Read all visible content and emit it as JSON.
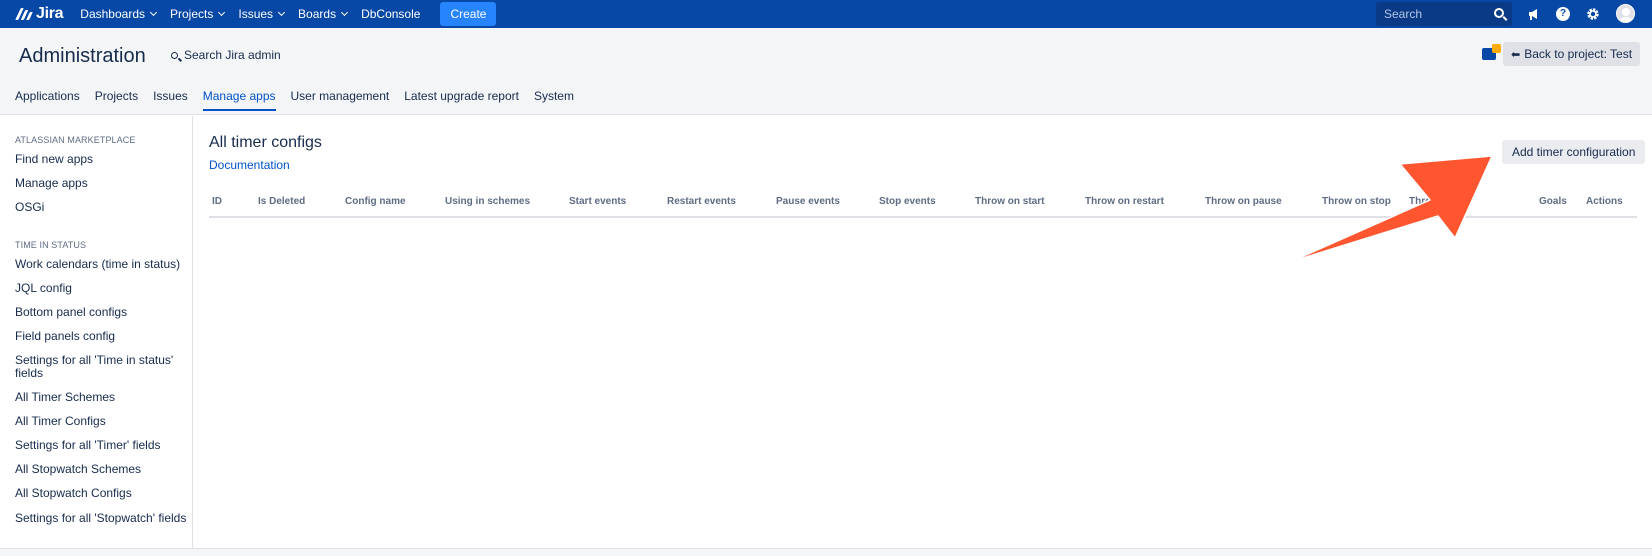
{
  "topbar": {
    "logo_text": "Jira",
    "nav": [
      {
        "label": "Dashboards",
        "dropdown": true
      },
      {
        "label": "Projects",
        "dropdown": true
      },
      {
        "label": "Issues",
        "dropdown": true
      },
      {
        "label": "Boards",
        "dropdown": true
      },
      {
        "label": "DbConsole",
        "dropdown": false
      }
    ],
    "create_label": "Create",
    "search_placeholder": "Search",
    "help_glyph": "?",
    "icons": [
      "megaphone-icon",
      "help-icon",
      "gear-icon",
      "avatar"
    ],
    "bg_color": "#0747a6"
  },
  "admin": {
    "title": "Administration",
    "search_label": "Search Jira admin",
    "back_label": "Back to project: Test",
    "tabs": [
      {
        "label": "Applications",
        "active": false
      },
      {
        "label": "Projects",
        "active": false
      },
      {
        "label": "Issues",
        "active": false
      },
      {
        "label": "Manage apps",
        "active": true
      },
      {
        "label": "User management",
        "active": false
      },
      {
        "label": "Latest upgrade report",
        "active": false
      },
      {
        "label": "System",
        "active": false
      }
    ]
  },
  "sidebar": {
    "sections": [
      {
        "heading": "ATLASSIAN MARKETPLACE",
        "items": [
          "Find new apps",
          "Manage apps",
          "OSGi"
        ]
      },
      {
        "heading": "TIME IN STATUS",
        "items": [
          "Work calendars (time in status)",
          "JQL config",
          "Bottom panel configs",
          "Field panels config",
          "Settings for all 'Time in status' fields",
          "All Timer Schemes",
          "All Timer Configs",
          "Settings for all 'Timer' fields",
          "All Stopwatch Schemes",
          "All Stopwatch Configs",
          "Settings for all 'Stopwatch' fields"
        ]
      }
    ]
  },
  "main": {
    "title": "All timer configs",
    "doc_link": "Documentation",
    "add_button": "Add timer configuration",
    "columns": [
      "ID",
      "Is Deleted",
      "Config name",
      "Using in schemes",
      "Start events",
      "Restart events",
      "Pause events",
      "Stop events",
      "Throw on start",
      "Throw on restart",
      "Throw on pause",
      "Throw on stop",
      "Throw on fail",
      "Goals",
      "Actions"
    ]
  },
  "annotation": {
    "arrow_color": "#ff5630"
  }
}
